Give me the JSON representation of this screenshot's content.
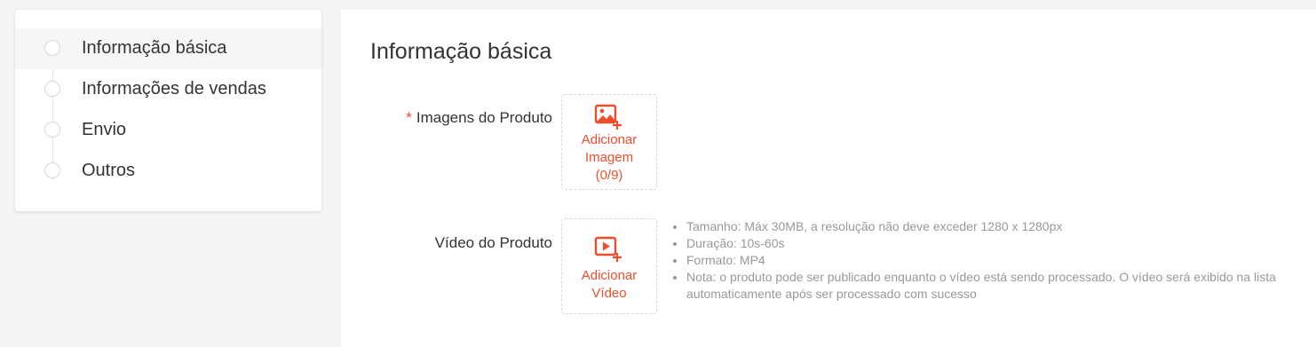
{
  "steps": [
    {
      "label": "Informação básica",
      "active": true
    },
    {
      "label": "Informações de vendas",
      "active": false
    },
    {
      "label": "Envio",
      "active": false
    },
    {
      "label": "Outros",
      "active": false
    }
  ],
  "section": {
    "title": "Informação básica"
  },
  "images_field": {
    "required_mark": "*",
    "label": "Imagens do Produto",
    "add_line1": "Adicionar",
    "add_line2": "Imagem",
    "count": "(0/9)",
    "icon": "image-add-icon"
  },
  "video_field": {
    "label": "Vídeo do Produto",
    "add_line1": "Adicionar",
    "add_line2": "Vídeo",
    "icon": "video-add-icon",
    "hints": [
      "Tamanho: Máx 30MB, a resolução não deve exceder 1280 x 1280px",
      "Duração: 10s-60s",
      "Formato: MP4",
      "Nota: o produto pode ser publicado enquanto o vídeo está sendo processado. O vídeo será exibido na lista automaticamente após ser processado com sucesso"
    ]
  },
  "colors": {
    "accent": "#ee4d2d",
    "hint": "#999999",
    "text": "#333333"
  }
}
